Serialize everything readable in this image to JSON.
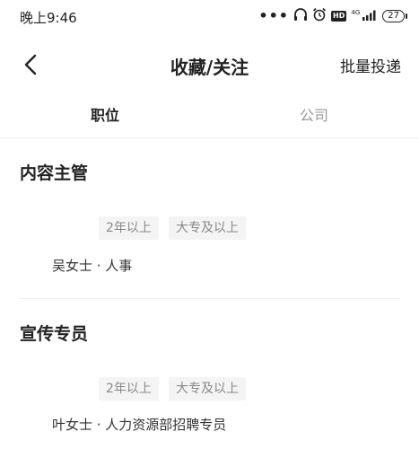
{
  "status": {
    "time": "晚上9:46",
    "dots": "•••",
    "hd": "HD",
    "network": "4G",
    "battery": "27"
  },
  "nav": {
    "title": "收藏/关注",
    "action": "批量投递"
  },
  "tabs": [
    {
      "label": "职位"
    },
    {
      "label": "公司"
    }
  ],
  "jobs": [
    {
      "title": "内容主管",
      "tags": [
        "2年以上",
        "大专及以上"
      ],
      "recruiter": "吴女士 · 人事"
    },
    {
      "title": "宣传专员",
      "tags": [
        "2年以上",
        "大专及以上"
      ],
      "recruiter": "叶女士 · 人力资源部招聘专员"
    }
  ]
}
